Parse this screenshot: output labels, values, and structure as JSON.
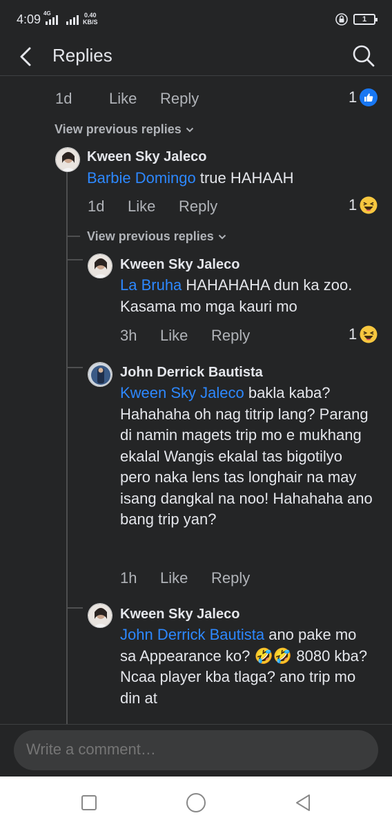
{
  "status": {
    "time": "4:09",
    "net_tag": "4G",
    "net_speed_value": "0.40",
    "net_speed_unit": "KB/S",
    "battery_level": "1"
  },
  "header": {
    "title": "Replies",
    "back_icon": "back-arrow-icon",
    "search_icon": "search-icon"
  },
  "top_partial": {
    "time": "1d",
    "like": "Like",
    "reply": "Reply",
    "reaction_count": "1",
    "reaction_icon": "like-reaction-icon"
  },
  "view_prev_1": "View previous replies",
  "view_prev_2": "View previous replies",
  "comments": [
    {
      "author": "Kween Sky Jaleco",
      "mention": "Barbie Domingo",
      "text": " true HAHAAH",
      "time": "1d",
      "like": "Like",
      "reply": "Reply",
      "reaction_count": "1"
    },
    {
      "author": "Kween Sky Jaleco",
      "mention": "La Bruha",
      "text": " HAHAHAHA dun ka zoo. Kasama mo mga kauri mo",
      "time": "3h",
      "like": "Like",
      "reply": "Reply",
      "reaction_count": "1"
    },
    {
      "author": "John Derrick Bautista",
      "mention": "Kween Sky Jaleco",
      "text": " bakla kaba? Hahahaha oh nag titrip lang? Parang di namin magets trip mo e mukhang ekalal Wangis ekalal tas bigotilyo pero naka lens tas longhair na may isang dangkal na noo! Hahahaha ano bang trip yan?",
      "time": "1h",
      "like": "Like",
      "reply": "Reply"
    },
    {
      "author": "Kween Sky Jaleco",
      "mention": "John Derrick Bautista",
      "text": " ano pake mo sa Appearance ko? 🤣🤣 8080 kba? Ncaa player kba tlaga? ano trip mo din at"
    }
  ],
  "composer": {
    "placeholder": "Write a comment…"
  },
  "colors": {
    "background": "#242526",
    "mention": "#2d88ff",
    "like_blue": "#1877f2",
    "text_secondary": "#b0b3b8"
  }
}
